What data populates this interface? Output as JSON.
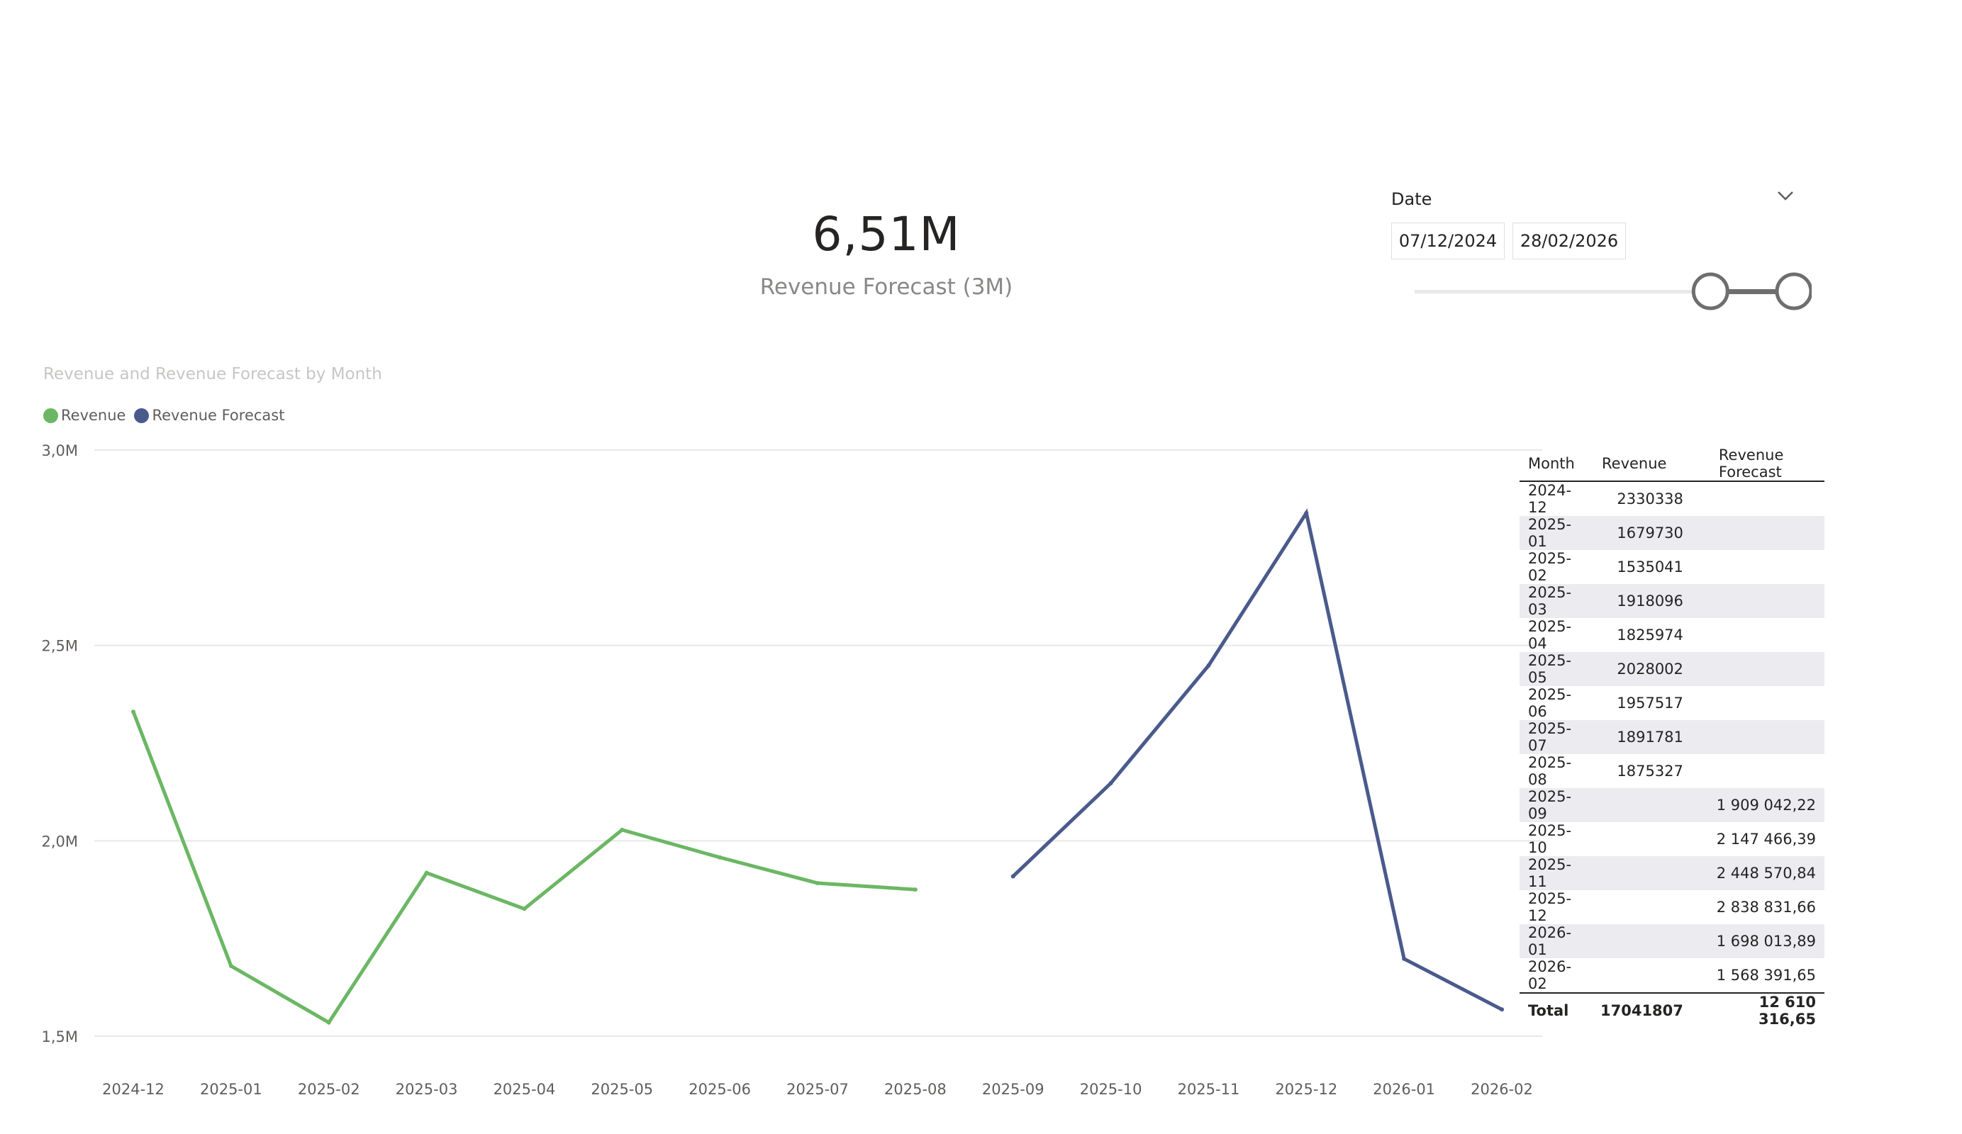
{
  "kpi": {
    "value": "6,51M",
    "label": "Revenue Forecast (3M)"
  },
  "date_slicer": {
    "title": "Date",
    "start": "07/12/2024",
    "end": "28/02/2026",
    "range_selected": [
      0.78,
      1.0
    ]
  },
  "chart_data": {
    "type": "line",
    "title": "Revenue and Revenue Forecast by Month",
    "categories": [
      "2024-12",
      "2025-01",
      "2025-02",
      "2025-03",
      "2025-04",
      "2025-05",
      "2025-06",
      "2025-07",
      "2025-08",
      "2025-09",
      "2025-10",
      "2025-11",
      "2025-12",
      "2026-01",
      "2026-02"
    ],
    "series": [
      {
        "name": "Revenue",
        "color": "#6bb764",
        "values": [
          2330338,
          1679730,
          1535041,
          1918096,
          1825974,
          2028002,
          1957517,
          1891781,
          1875327,
          null,
          null,
          null,
          null,
          null,
          null
        ]
      },
      {
        "name": "Revenue Forecast",
        "color": "#4a5a8c",
        "values": [
          null,
          null,
          null,
          null,
          null,
          null,
          null,
          null,
          null,
          1909042.22,
          2147466.39,
          2448570.84,
          2838831.66,
          1698013.89,
          1568391.65
        ]
      }
    ],
    "y_ticks": [
      "1,5M",
      "2,0M",
      "2,5M",
      "3,0M"
    ],
    "ylim": [
      1500000,
      3000000
    ],
    "grid": true,
    "legend_position": "top-left"
  },
  "table": {
    "columns": [
      "Month",
      "Revenue",
      "Revenue Forecast"
    ],
    "rows": [
      [
        "2024-12",
        "2330338",
        ""
      ],
      [
        "2025-01",
        "1679730",
        ""
      ],
      [
        "2025-02",
        "1535041",
        ""
      ],
      [
        "2025-03",
        "1918096",
        ""
      ],
      [
        "2025-04",
        "1825974",
        ""
      ],
      [
        "2025-05",
        "2028002",
        ""
      ],
      [
        "2025-06",
        "1957517",
        ""
      ],
      [
        "2025-07",
        "1891781",
        ""
      ],
      [
        "2025-08",
        "1875327",
        ""
      ],
      [
        "2025-09",
        "",
        "1 909 042,22"
      ],
      [
        "2025-10",
        "",
        "2 147 466,39"
      ],
      [
        "2025-11",
        "",
        "2 448 570,84"
      ],
      [
        "2025-12",
        "",
        "2 838 831,66"
      ],
      [
        "2026-01",
        "",
        "1 698 013,89"
      ],
      [
        "2026-02",
        "",
        "1 568 391,65"
      ]
    ],
    "total": [
      "Total",
      "17041807",
      "12 610 316,65"
    ]
  }
}
